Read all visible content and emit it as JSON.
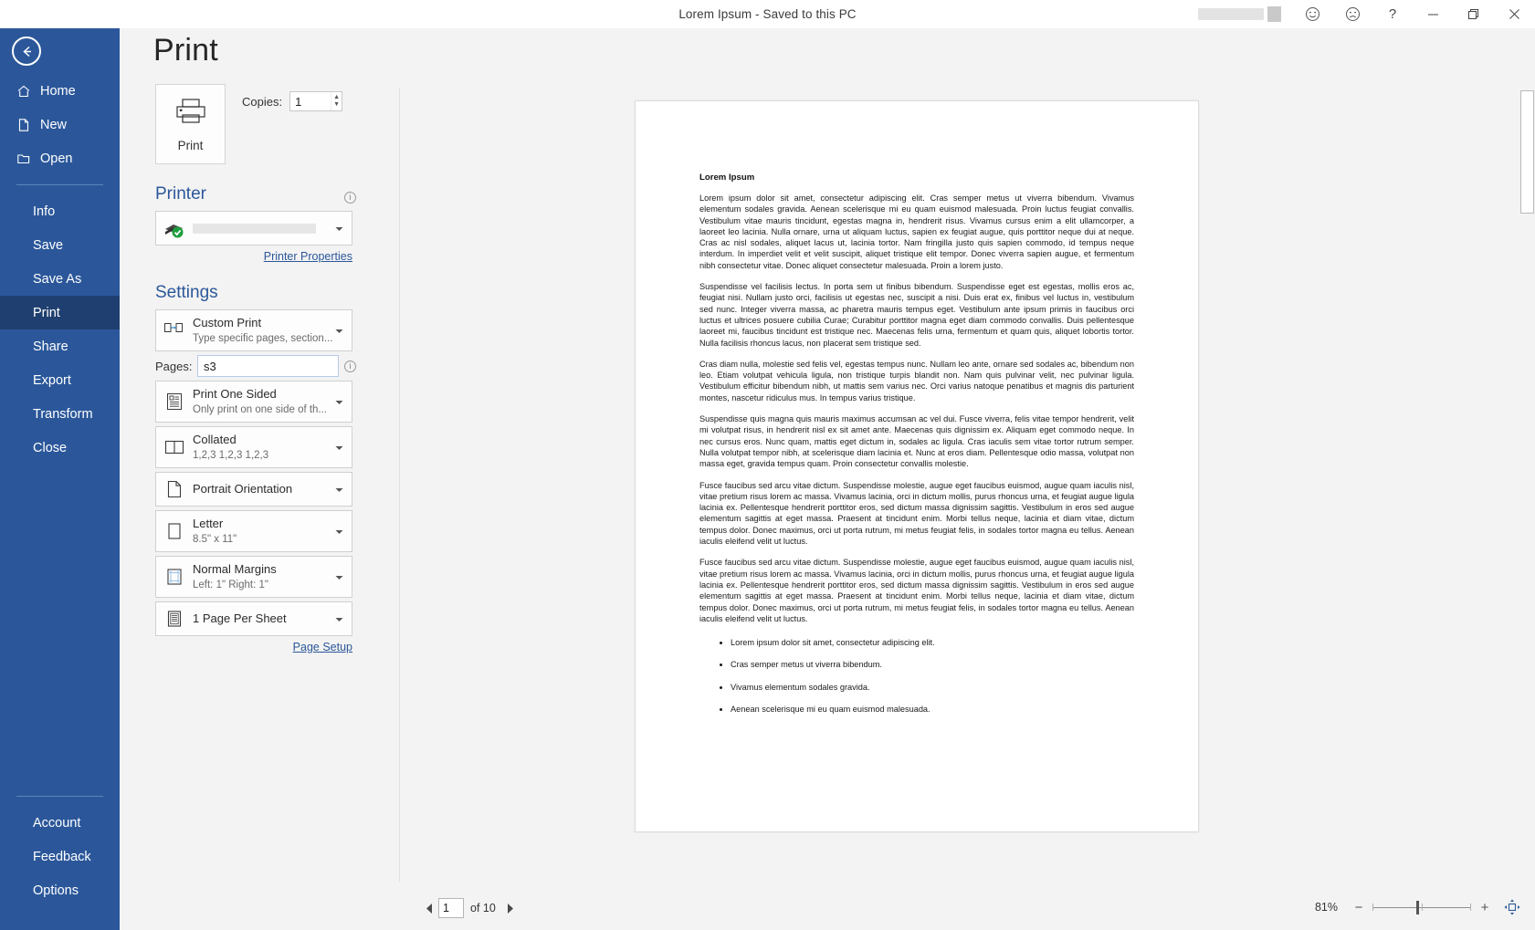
{
  "titlebar": {
    "document_title": "Lorem Ipsum  -  Saved to this PC",
    "help_label": "?",
    "minimize_label": "–",
    "restore_label": "❐",
    "close_label": "✕"
  },
  "nav": {
    "back_label": "",
    "top_items": [
      {
        "label": "Home",
        "icon": "home-icon",
        "active": false
      },
      {
        "label": "New",
        "icon": "new-document-icon",
        "active": false
      },
      {
        "label": "Open",
        "icon": "open-folder-icon",
        "active": false
      }
    ],
    "list_items": [
      {
        "label": "Info",
        "active": false
      },
      {
        "label": "Save",
        "active": false
      },
      {
        "label": "Save As",
        "active": false
      },
      {
        "label": "Print",
        "active": true
      },
      {
        "label": "Share",
        "active": false
      },
      {
        "label": "Export",
        "active": false
      },
      {
        "label": "Transform",
        "active": false
      },
      {
        "label": "Close",
        "active": false
      }
    ],
    "bottom_items": [
      {
        "label": "Account"
      },
      {
        "label": "Feedback"
      },
      {
        "label": "Options"
      }
    ]
  },
  "page": {
    "title": "Print"
  },
  "print_button": {
    "label": "Print",
    "icon": "printer-icon"
  },
  "copies": {
    "label": "Copies:",
    "value": "1",
    "up_arrow": "▲",
    "down_arrow": "▼"
  },
  "printer": {
    "section_title": "Printer",
    "info_icon": "i",
    "selected_name": "",
    "status_icon": "printer-ready-check-icon",
    "properties_link": "Printer Properties"
  },
  "settings": {
    "section_title": "Settings",
    "page_setup_link": "Page Setup",
    "pages_label": "Pages:",
    "pages_value": "s3",
    "pages_placeholder": "",
    "items": [
      {
        "name": "print-range",
        "icon": "custom-print-icon",
        "primary": "Custom Print",
        "secondary": "Type specific pages, section..."
      },
      {
        "name": "print-sides",
        "icon": "one-sided-icon",
        "primary": "Print One Sided",
        "secondary": "Only print on one side of th..."
      },
      {
        "name": "collation",
        "icon": "collated-icon",
        "primary": "Collated",
        "secondary": "1,2,3   1,2,3   1,2,3"
      },
      {
        "name": "orientation",
        "icon": "portrait-icon",
        "primary": "Portrait Orientation",
        "secondary": ""
      },
      {
        "name": "paper-size",
        "icon": "paper-size-icon",
        "primary": "Letter",
        "secondary": "8.5\" x 11\""
      },
      {
        "name": "margins",
        "icon": "margins-icon",
        "primary": "Normal Margins",
        "secondary": "Left:  1\"   Right:  1\""
      },
      {
        "name": "pages-per-sheet",
        "icon": "pages-per-sheet-icon",
        "primary": "1 Page Per Sheet",
        "secondary": ""
      }
    ]
  },
  "document_preview": {
    "heading": "Lorem Ipsum",
    "paragraphs": [
      "Lorem ipsum dolor sit amet, consectetur adipiscing elit. Cras semper metus ut viverra bibendum. Vivamus elementum sodales gravida. Aenean scelerisque mi eu quam euismod malesuada. Proin luctus feugiat convallis. Vestibulum vitae mauris tincidunt, egestas magna in, hendrerit risus. Vivamus cursus enim a elit ullamcorper, a laoreet leo lacinia. Nulla ornare, urna ut aliquam luctus, sapien ex feugiat augue, quis porttitor neque dui at neque. Cras ac nisl sodales, aliquet lacus ut, lacinia tortor. Nam fringilla justo quis sapien commodo, id tempus neque interdum. In imperdiet velit et velit suscipit, aliquet tristique elit tempor. Donec viverra sapien augue, et fermentum nibh consectetur vitae. Donec aliquet consectetur malesuada. Proin a lorem justo.",
      "Suspendisse vel facilisis lectus. In porta sem ut finibus bibendum. Suspendisse eget est egestas, mollis eros ac, feugiat nisi. Nullam justo orci, facilisis ut egestas nec, suscipit a nisi. Duis erat ex, finibus vel luctus in, vestibulum sed nunc. Integer viverra massa, ac pharetra mauris tempus eget. Vestibulum ante ipsum primis in faucibus orci luctus et ultrices posuere cubilia Curae; Curabitur porttitor magna eget diam commodo convallis. Duis pellentesque laoreet mi, faucibus tincidunt est tristique nec. Maecenas felis urna, fermentum et quam quis, aliquet lobortis tortor. Nulla facilisis rhoncus lacus, non placerat sem tristique sed.",
      "Cras diam nulla, molestie sed felis vel, egestas tempus nunc. Nullam leo ante, ornare sed sodales ac, bibendum non leo. Etiam volutpat vehicula ligula, non tristique turpis blandit non. Nam quis pulvinar velit, nec pulvinar ligula. Vestibulum efficitur bibendum nibh, ut mattis sem varius nec. Orci varius natoque penatibus et magnis dis parturient montes, nascetur ridiculus mus. In tempus varius tristique.",
      "Suspendisse quis magna quis mauris maximus accumsan ac vel dui. Fusce viverra, felis vitae tempor hendrerit, velit mi volutpat risus, in hendrerit nisl ex sit amet ante. Maecenas quis dignissim ex. Aliquam eget commodo neque. In nec cursus eros. Nunc quam, mattis eget dictum in, sodales ac ligula. Cras iaculis sem vitae tortor rutrum semper. Nulla volutpat tempor nibh, at scelerisque diam lacinia et. Nunc at eros diam. Pellentesque odio massa, volutpat non massa eget, gravida tempus quam. Proin consectetur convallis molestie.",
      "Fusce faucibus sed arcu vitae dictum. Suspendisse molestie, augue eget faucibus euismod, augue quam iaculis nisl, vitae pretium risus lorem ac massa. Vivamus lacinia, orci in dictum mollis, purus rhoncus urna, et feugiat augue ligula lacinia ex. Pellentesque hendrerit porttitor eros, sed dictum massa dignissim sagittis. Vestibulum in eros sed augue elementum sagittis at eget massa. Praesent at tincidunt enim. Morbi tellus neque, lacinia et diam vitae, dictum tempus dolor. Donec maximus, orci ut porta rutrum, mi metus feugiat felis, in sodales tortor magna eu tellus. Aenean iaculis eleifend velit ut luctus.",
      "Fusce faucibus sed arcu vitae dictum. Suspendisse molestie, augue eget faucibus euismod, augue quam iaculis nisl, vitae pretium risus lorem ac massa. Vivamus lacinia, orci in dictum mollis, purus rhoncus urna, et feugiat augue ligula lacinia ex. Pellentesque hendrerit porttitor eros, sed dictum massa dignissim sagittis. Vestibulum in eros sed augue elementum sagittis at eget massa. Praesent at tincidunt enim. Morbi tellus neque, lacinia et diam vitae, dictum tempus dolor. Donec maximus, orci ut porta rutrum, mi metus feugiat felis, in sodales tortor magna eu tellus. Aenean iaculis eleifend velit ut luctus."
    ],
    "bullets": [
      "Lorem ipsum dolor sit amet, consectetur adipiscing elit.",
      "Cras semper metus ut viverra bibendum.",
      "Vivamus elementum sodales gravida.",
      "Aenean scelerisque mi eu quam euismod malesuada."
    ]
  },
  "statusbar": {
    "current_page": "1",
    "of_label": "of 10",
    "prev_arrow": "◀",
    "next_arrow": "▶",
    "zoom_percent": "81%",
    "zoom_out_label": "−",
    "zoom_in_label": "+",
    "zoom_to_page_icon": "zoom-to-page-icon"
  },
  "colors": {
    "brand_blue": "#2b579a",
    "active_nav": "#1e3f6f",
    "app_bg": "#f3f3f3",
    "link_blue": "#2b579a",
    "ready_green": "#1e9e3e"
  }
}
